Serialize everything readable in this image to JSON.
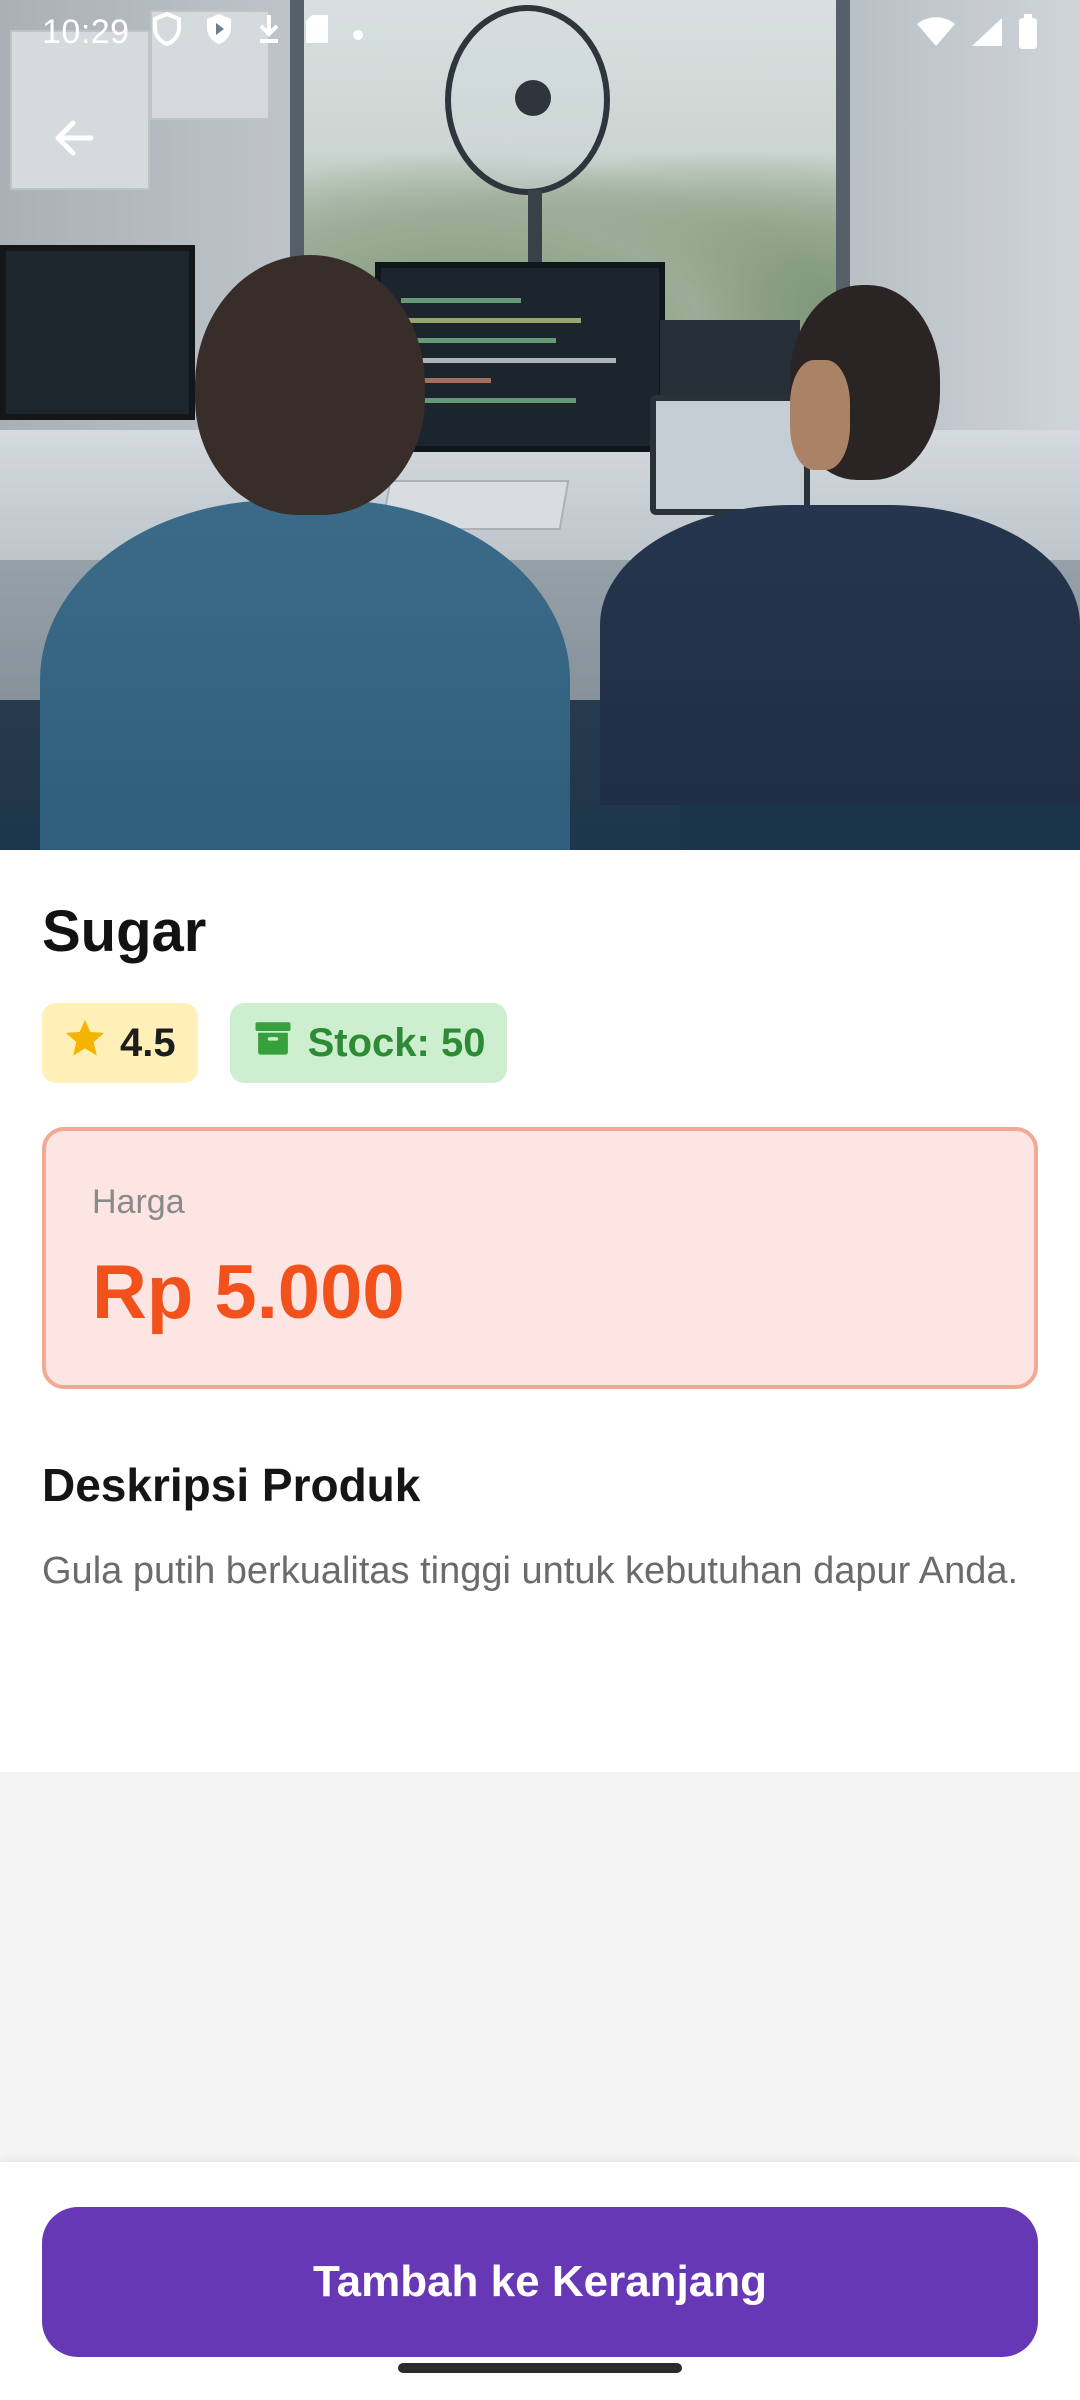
{
  "status_bar": {
    "time": "10:29",
    "icons_left": [
      "shield-icon",
      "play-protect-icon",
      "download-icon",
      "sd-card-icon",
      "dot-icon"
    ],
    "icons_right": [
      "wifi-icon",
      "signal-icon",
      "battery-icon"
    ]
  },
  "hero": {
    "image": "photo of two people working at computers by a window"
  },
  "navigation": {
    "back_icon": "arrow-left-icon"
  },
  "product": {
    "title": "Sugar",
    "rating": "4.5",
    "stock_label": "Stock: 50",
    "price_label": "Harga",
    "price_value": "Rp 5.000",
    "description_title": "Deskripsi Produk",
    "description": "Gula putih berkualitas tinggi untuk kebutuhan dapur Anda."
  },
  "actions": {
    "add_to_cart_label": "Tambah ke Keranjang"
  },
  "colors": {
    "primary": "#6638b5",
    "price": "#f2511b",
    "rating_bg": "#fff0b8",
    "stock_bg": "#cdeecf",
    "stock_text": "#2e8b35",
    "price_box_bg": "#fce5e3",
    "price_box_border": "#f3a894"
  }
}
